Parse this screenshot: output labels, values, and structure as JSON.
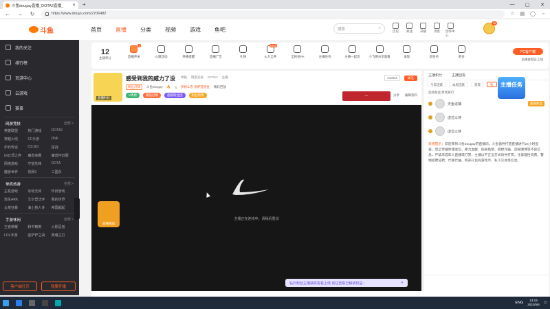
{
  "browser": {
    "tab_title": "斗鱼dougay直播_DOTA2直播_",
    "url": "https://www.douyu.com/2706482",
    "new_tab": "+",
    "minimize": "—",
    "maximize": "▢",
    "close": "✕"
  },
  "site": {
    "logo_text": "斗鱼",
    "nav": [
      "首页",
      "直播",
      "分类",
      "视频",
      "游戏",
      "鱼吧"
    ],
    "search_placeholder": "搜索",
    "header_icons": [
      "历史",
      "关注",
      "开播",
      "消息",
      "创作中心"
    ]
  },
  "sidebar": {
    "top_items": [
      "我的关注",
      "排行榜",
      "页游中心",
      "云游戏",
      "赛事"
    ],
    "section1": {
      "title": "网游竞技",
      "more": "全部 >",
      "items": [
        "英雄联盟",
        "热门游戏",
        "DOTA2",
        "穿越火线",
        "CF手游",
        "DNF",
        "炉石传说",
        "CS:GO",
        "逆战",
        "lol云顶之弈",
        "魔兽争霸",
        "魔兽怀旧服",
        "网络游戏",
        "守望先锋",
        "DOTA",
        "魔兽世界",
        "剑网3",
        "三国杀"
      ]
    },
    "section2": {
      "title": "单机热游",
      "more": "全部 >",
      "items": [
        "主机游戏",
        "永劫无间",
        "怀旧游戏",
        "逃生ARK",
        "艾尔登法环",
        "我的世界",
        "太荒狂暴",
        "海上挑人多",
        "帝国崛起"
      ]
    },
    "section3": {
      "title": "手游休闲",
      "more": "全部 >",
      "items": [
        "王者荣耀",
        "和平精英",
        "火影忍者",
        "LOL手游",
        "金铲铲之战",
        "英魂之刃"
      ]
    },
    "btn_client": "客户端打开",
    "btn_live": "我要开播"
  },
  "funcbar": {
    "level_num": "12",
    "level_label": "主播积分",
    "items": [
      {
        "label": "直播开关",
        "badge": "1"
      },
      {
        "label": "心跳活动",
        "badge": ""
      },
      {
        "label": "开播提醒",
        "badge": ""
      },
      {
        "label": "直播广告",
        "badge": ""
      },
      {
        "label": "礼物",
        "badge": ""
      },
      {
        "label": "火力全开",
        "badge": "NEW"
      },
      {
        "label": "全民抗PK",
        "badge": ""
      },
      {
        "label": "主播任务",
        "badge": ""
      },
      {
        "label": "主播一起玩",
        "badge": ""
      },
      {
        "label": "小飞碟分享观看",
        "badge": ""
      },
      {
        "label": "发现",
        "badge": ""
      },
      {
        "label": "周任务",
        "badge": ""
      },
      {
        "label": "更多",
        "badge": ""
      }
    ],
    "pc_button": "PC客户端",
    "pc_sub": "主播金刚正上线"
  },
  "room": {
    "avatar_tag": "直播时长",
    "title": "感受到我的威力了没",
    "meta": [
      "举报",
      "网游竞技",
      "DOTA2",
      "主播"
    ],
    "anchor_name": "斗鱼dougay",
    "level": "4",
    "tag1": "粉丝灯牌",
    "tag_warn": "梦想斗志·德萨克赏金",
    "tag_record": "精彩回放",
    "pills": [
      {
        "text": "V周榜",
        "color": "#3cb371"
      },
      {
        "text": "最强召唤",
        "color": "#ff6a3d"
      },
      {
        "text": "超级粉丝团",
        "color": "#7a5af8"
      },
      {
        "text": "粉丝榜第",
        "color": "#f5a623"
      }
    ],
    "hot": "210011",
    "follow": "关注",
    "ribbon_text": "一",
    "extra": [
      "分享",
      "编辑资料"
    ]
  },
  "player": {
    "message": "主播正在连线中，请稍后重试",
    "gift_label": "直播挑战",
    "notice": "钻石粉丝主播抽奖看看上线 前往查看已解锁权益 ›",
    "notice_close": "✕"
  },
  "rpanel": {
    "tabs": [
      "主播积分",
      "主播回看"
    ],
    "subtabs": [
      {
        "label": "今日活跃",
        "on": false
      },
      {
        "label": "本周活跃",
        "on": false
      },
      {
        "label": "贵宾",
        "on": false
      },
      {
        "label": "钻",
        "on": true
      }
    ],
    "rank_title": "连续粉丝/贵宾排行",
    "rank_rows": [
      {
        "name": "天鱼追捕",
        "badge": "超级粉丝"
      },
      {
        "name": "虚位以待",
        "badge": ""
      },
      {
        "name": "虚位以待",
        "badge": ""
      }
    ],
    "sys_key": "系统提示：",
    "sys_text": "欢迎来到斗鱼dougay的直播间。斗鱼倡导打造直播进行24小时监查，禁止传播封建迷信、暴力血腥、低俗色情、招嫖诈骗、违规赌博等不良信息。严禁未成年人直播或打赏，主播以不正当方式诱导打赏，注意理性消费，警惕招聘证聘、代练代抽、购买礼包码游戏币、私下交易等信息。",
    "promo_text": "主播任务"
  },
  "taskbar": {
    "lang": "ENG",
    "time": "13:19",
    "date": "2022/5/6"
  }
}
